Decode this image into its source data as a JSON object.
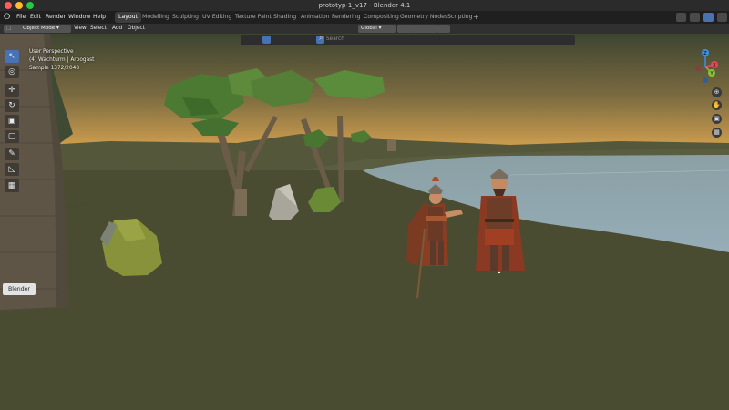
{
  "window": {
    "title": "prototyp-1_v17 - Blender 4.1"
  },
  "menu": {
    "file": "File",
    "edit": "Edit",
    "render": "Render",
    "window": "Window",
    "help": "Help"
  },
  "workspaces": [
    "Layout",
    "Modelling",
    "Sculpting",
    "UV Editing",
    "Texture Paint",
    "Shading",
    "Animation",
    "Rendering",
    "Compositing",
    "Geometry Nodes",
    "Scripting"
  ],
  "workspace_add": "+",
  "header": {
    "mode": "Object Mode",
    "view": "View",
    "select": "Select",
    "add": "Add",
    "object": "Object",
    "transform_orientation": "Global",
    "search_placeholder": "Search"
  },
  "viewport": {
    "perspective": "User Perspective",
    "collection": "(4) Wachturm | Arbogast",
    "sample": "Sample 1372/2048"
  },
  "tooltip": "Blender",
  "gizmo": {
    "x": "X",
    "y": "Y",
    "z": "Z"
  },
  "colors": {
    "active_tool": "#4772b3",
    "x_axis": "#e04a5b",
    "y_axis": "#86c23b",
    "z_axis": "#3f8de6"
  }
}
